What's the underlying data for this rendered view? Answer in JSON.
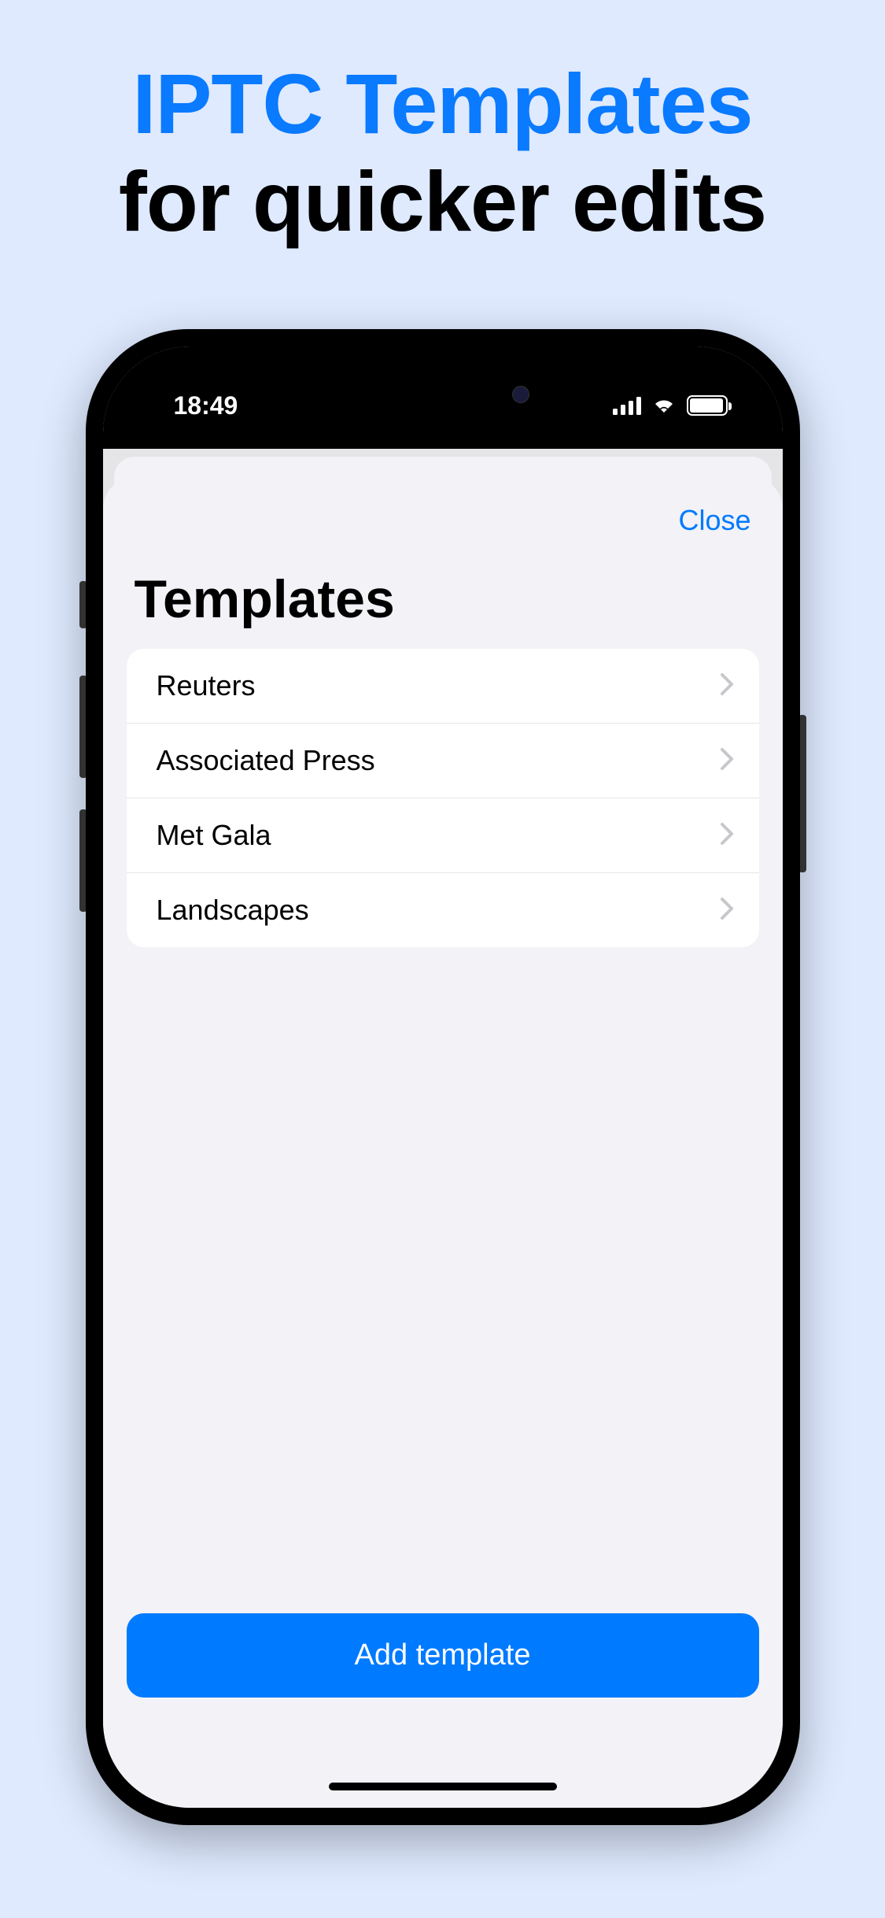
{
  "marketing": {
    "line1": "IPTC Templates",
    "line2": "for quicker edits"
  },
  "status": {
    "time": "18:49"
  },
  "modal": {
    "close_label": "Close",
    "title": "Templates",
    "add_button": "Add template"
  },
  "templates": [
    {
      "label": "Reuters"
    },
    {
      "label": "Associated Press"
    },
    {
      "label": "Met Gala"
    },
    {
      "label": "Landscapes"
    }
  ]
}
